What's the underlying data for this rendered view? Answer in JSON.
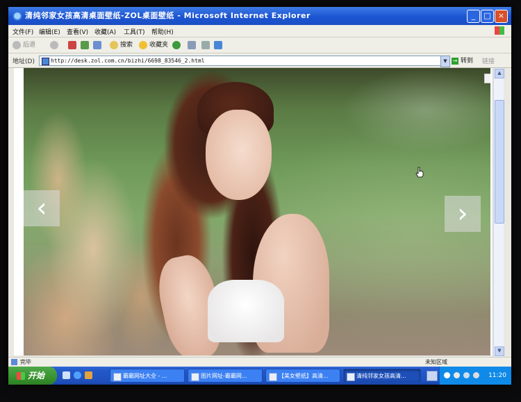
{
  "window": {
    "title": "清纯邻家女孩高清桌面壁纸-ZOL桌面壁纸 - Microsoft Internet Explorer",
    "minimize": "_",
    "maximize": "□",
    "close": "×"
  },
  "menu": [
    "文件(F)",
    "编辑(E)",
    "查看(V)",
    "收藏(A)",
    "工具(T)",
    "帮助(H)"
  ],
  "toolbar": {
    "back": "后退",
    "search": "搜索",
    "favorites": "收藏夹"
  },
  "address": {
    "label": "地址(D)",
    "url": "http://desk.zol.com.cn/bizhi/6698_83546_2.html",
    "go": "转到",
    "links": "链接"
  },
  "viewer": {
    "prev": "‹",
    "next": "›"
  },
  "status": {
    "text": "完毕",
    "zone": "未知区域"
  },
  "taskbar": {
    "start": "开始",
    "tasks": [
      "霸霸网址大全 - ...",
      "图片网址-霸霸网...",
      "【美女壁纸】高清...",
      "清纯邻家女孩高清..."
    ],
    "active_task": 3,
    "clock": "11:20"
  }
}
